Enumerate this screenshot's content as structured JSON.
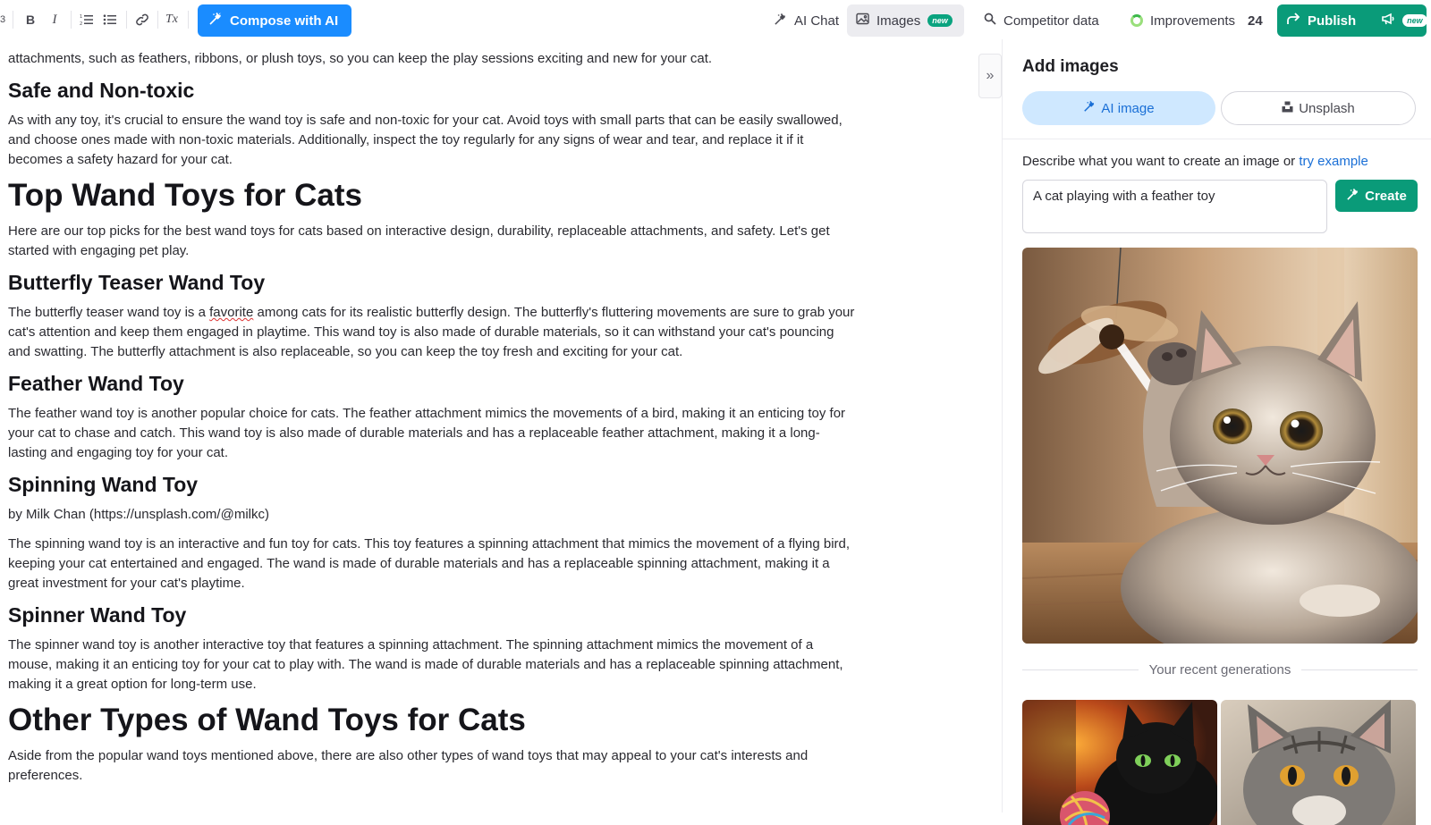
{
  "toolbar": {
    "heading_marker": "3",
    "format_buttons": [
      {
        "name": "bold-icon",
        "glyph": "B"
      },
      {
        "name": "italic-icon",
        "glyph": "I"
      },
      {
        "name": "ordered-list-icon",
        "glyph": "≡"
      },
      {
        "name": "bullet-list-icon",
        "glyph": "☰"
      },
      {
        "name": "link-icon",
        "glyph": "🔗"
      },
      {
        "name": "clear-format-icon",
        "glyph": "Tx"
      }
    ],
    "compose_label": "Compose with AI",
    "ai_chat_label": "AI Chat",
    "images_label": "Images",
    "images_badge": "new",
    "competitor_label": "Competitor data",
    "improvements_label": "Improvements",
    "improvements_count": "24",
    "publish_label": "Publish",
    "publish_badge": "new"
  },
  "article": {
    "cut_line": "attachments, such as feathers, ribbons, or plush toys, so you can keep the play sessions exciting and new for your cat.",
    "h_safe": "Safe and Non-toxic",
    "p_safe": "As with any toy, it's crucial to ensure the wand toy is safe and non-toxic for your cat. Avoid toys with small parts that can be easily swallowed, and choose ones made with non-toxic materials. Additionally, inspect the toy regularly for any signs of wear and tear, and replace it if it becomes a safety hazard for your cat.",
    "h_top": "Top Wand Toys for Cats",
    "p_top": "Here are our top picks for the best wand toys for cats based on interactive design, durability, replaceable attachments, and safety. Let's get started with engaging pet play.",
    "h_butterfly": "Butterfly Teaser Wand Toy",
    "p_butterfly_a": "The butterfly teaser wand toy is a ",
    "p_butterfly_misspelled": "favorite",
    "p_butterfly_b": " among cats for its realistic butterfly design. The butterfly's fluttering movements are sure to grab your cat's attention and keep them engaged in playtime. This wand toy is also made of durable materials, so it can withstand your cat's pouncing and swatting. The butterfly attachment is also replaceable, so you can keep the toy fresh and exciting for your cat.",
    "h_feather": "Feather Wand Toy",
    "p_feather": "The feather wand toy is another popular choice for cats. The feather attachment mimics the movements of a bird, making it an enticing toy for your cat to chase and catch. This wand toy is also made of durable materials and has a replaceable feather attachment, making it a long-lasting and engaging toy for your cat.",
    "h_spinning": "Spinning Wand Toy",
    "p_credit": "by Milk Chan (https://unsplash.com/@milkc)",
    "p_spinning": "The spinning wand toy is an interactive and fun toy for cats. This toy features a spinning attachment that mimics the movement of a flying bird, keeping your cat entertained and engaged. The wand is made of durable materials and has a replaceable spinning attachment, making it a great investment for your cat's playtime.",
    "h_spinner": "Spinner Wand Toy",
    "p_spinner": "The spinner wand toy is another interactive toy that features a spinning attachment. The spinning attachment mimics the movement of a mouse, making it an enticing toy for your cat to play with. The wand is made of durable materials and has a replaceable spinning attachment, making it a great option for long-term use.",
    "h_other": "Other Types of Wand Toys for Cats",
    "p_other": "Aside from the popular wand toys mentioned above, there are also other types of wand toys that may appeal to your cat's interests and preferences."
  },
  "panel": {
    "collapse_glyph": "»",
    "title": "Add images",
    "tab_ai": "AI image",
    "tab_unsplash": "Unsplash",
    "prompt_desc": "Describe what you want to create an image or ",
    "try_example": "try example",
    "prompt_value": "A cat playing with a feather toy",
    "create_label": "Create",
    "recent_label": "Your recent generations"
  },
  "colors": {
    "accent_blue": "#1a8cff",
    "publish_green": "#0a9b79",
    "active_tab_bg": "#cfe8ff",
    "link_blue": "#1a6fd6"
  }
}
